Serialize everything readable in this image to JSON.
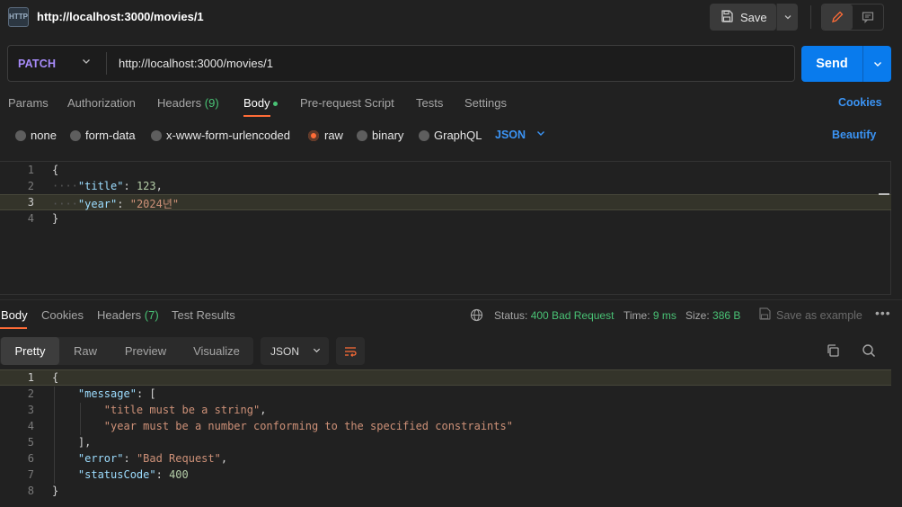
{
  "tab": {
    "title": "http://localhost:3000/movies/1",
    "icon": "http-file-icon"
  },
  "toolbar": {
    "save_label": "Save"
  },
  "request": {
    "method": "PATCH",
    "url": "http://localhost:3000/movies/1",
    "send_label": "Send"
  },
  "request_tabs": {
    "params": "Params",
    "authorization": "Authorization",
    "headers": "Headers",
    "headers_count": "(9)",
    "body": "Body",
    "pre_request": "Pre-request Script",
    "tests": "Tests",
    "settings": "Settings",
    "cookies": "Cookies"
  },
  "body_types": {
    "none": "none",
    "form_data": "form-data",
    "urlencoded": "x-www-form-urlencoded",
    "raw": "raw",
    "binary": "binary",
    "graphql": "GraphQL",
    "format": "JSON",
    "beautify": "Beautify",
    "selected": "raw"
  },
  "request_body": {
    "line_numbers": [
      "1",
      "2",
      "3",
      "4"
    ],
    "l1_brace": "{",
    "l2_key": "\"title\"",
    "l2_colon": ": ",
    "l2_value": "123",
    "l2_comma": ",",
    "l3_key": "\"year\"",
    "l3_colon": ": ",
    "l3_value": "\"2024년\"",
    "l4_brace": "}"
  },
  "response_tabs": {
    "body": "Body",
    "cookies": "Cookies",
    "headers": "Headers",
    "headers_count": "(7)",
    "test_results": "Test Results"
  },
  "response_meta": {
    "status_label": "Status:",
    "status_value": "400 Bad Request",
    "time_label": "Time:",
    "time_value": "9 ms",
    "size_label": "Size:",
    "size_value": "386 B",
    "save_example": "Save as example"
  },
  "response_view": {
    "pretty": "Pretty",
    "raw": "Raw",
    "preview": "Preview",
    "visualize": "Visualize",
    "format": "JSON"
  },
  "response_body": {
    "line_numbers": [
      "1",
      "2",
      "3",
      "4",
      "5",
      "6",
      "7",
      "8"
    ],
    "l1": "{",
    "l2_key": "\"message\"",
    "l2_rest": ": [",
    "l3_value": "\"title must be a string\"",
    "l3_comma": ",",
    "l4_value": "\"year must be a number conforming to the specified constraints\"",
    "l5": "],",
    "l6_key": "\"error\"",
    "l6_colon": ": ",
    "l6_value": "\"Bad Request\"",
    "l6_comma": ",",
    "l7_key": "\"statusCode\"",
    "l7_colon": ": ",
    "l7_value": "400",
    "l8": "}"
  },
  "colors": {
    "accent": "#ff6c37",
    "send": "#097bed",
    "method": "#a78bfa",
    "status_ok_green": "#49c275",
    "link": "#3b94f5"
  }
}
